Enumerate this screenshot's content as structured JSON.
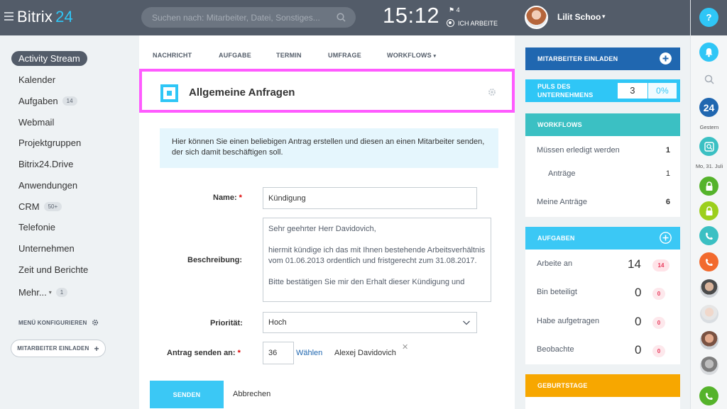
{
  "topbar": {
    "logo_text": "Bitrix",
    "logo_num": "24",
    "search_placeholder": "Suchen nach: Mitarbeiter, Datei, Sonstiges...",
    "clock": "15:12",
    "flag_count": "4",
    "work_status": "ICH ARBEITE",
    "user_name": "Lilit Schoo"
  },
  "sidebar": {
    "items": [
      {
        "label": "Activity Stream"
      },
      {
        "label": "Kalender"
      },
      {
        "label": "Aufgaben",
        "badge": "14"
      },
      {
        "label": "Webmail"
      },
      {
        "label": "Projektgruppen"
      },
      {
        "label": "Bitrix24.Drive"
      },
      {
        "label": "Anwendungen"
      },
      {
        "label": "CRM",
        "badge": "50+"
      },
      {
        "label": "Telefonie"
      },
      {
        "label": "Unternehmen"
      },
      {
        "label": "Zeit und Berichte"
      },
      {
        "label": "Mehr...",
        "badge": "1"
      }
    ],
    "menu_config": "MENÜ KONFIGURIEREN",
    "invite_button": "MITARBEITER EINLADEN"
  },
  "tabs": [
    "NACHRICHT",
    "AUFGABE",
    "TERMIN",
    "UMFRAGE",
    "WORKFLOWS"
  ],
  "form": {
    "title": "Allgemeine Anfragen",
    "info": "Hier können Sie einen beliebigen Antrag erstellen und diesen an einen Mitarbeiter senden, der sich damit beschäftigen soll.",
    "name_label": "Name:",
    "name_value": "Kündigung",
    "desc_label": "Beschreibung:",
    "desc_value": "Sehr geehrter Herr Davidovich,\n\nhiermit kündige ich das mit Ihnen bestehende Arbeitsverhältnis vom 01.06.2013 ordentlich und fristgerecht zum 31.08.2017.\n\nBitte bestätigen Sie mir den Erhalt dieser Kündigung und",
    "prio_label": "Priorität:",
    "prio_value": "Hoch",
    "recipient_label": "Antrag senden an:",
    "recipient_id": "36",
    "recipient_choose": "Wählen",
    "recipient_name": "Alexej Davidovich",
    "send_button": "SENDEN",
    "cancel_button": "Abbrechen"
  },
  "right": {
    "invite": "MITARBEITER EINLADEN",
    "pulse_label_1": "PULS DES",
    "pulse_label_2": "UNTERNEHMENS",
    "pulse_value": "3",
    "pulse_percent": "0%",
    "workflows": {
      "title": "WORKFLOWS",
      "rows": [
        {
          "label": "Müssen erledigt werden",
          "value": "1"
        },
        {
          "label": "Anträge",
          "value": "1"
        },
        {
          "label": "Meine Anträge",
          "value": "6"
        }
      ]
    },
    "tasks": {
      "title": "AUFGABEN",
      "rows": [
        {
          "label": "Arbeite an",
          "value": "14",
          "badge": "14"
        },
        {
          "label": "Bin beteiligt",
          "value": "0",
          "badge": "0"
        },
        {
          "label": "Habe aufgetragen",
          "value": "0",
          "badge": "0"
        },
        {
          "label": "Beobachte",
          "value": "0",
          "badge": "0"
        }
      ]
    },
    "birthdays": "GEBURTSTAGE"
  },
  "rightstrip": {
    "help": "?",
    "badge_24": "24",
    "label_gestern": "Gestern",
    "label_date": "Mo, 31. Juli"
  },
  "colors": {
    "topbar": "#535c69",
    "accent": "#2fc6f6",
    "teal": "#3bc0c3",
    "orange": "#f7a700",
    "navy": "#2067b0",
    "highlight": "#ff5bff"
  }
}
